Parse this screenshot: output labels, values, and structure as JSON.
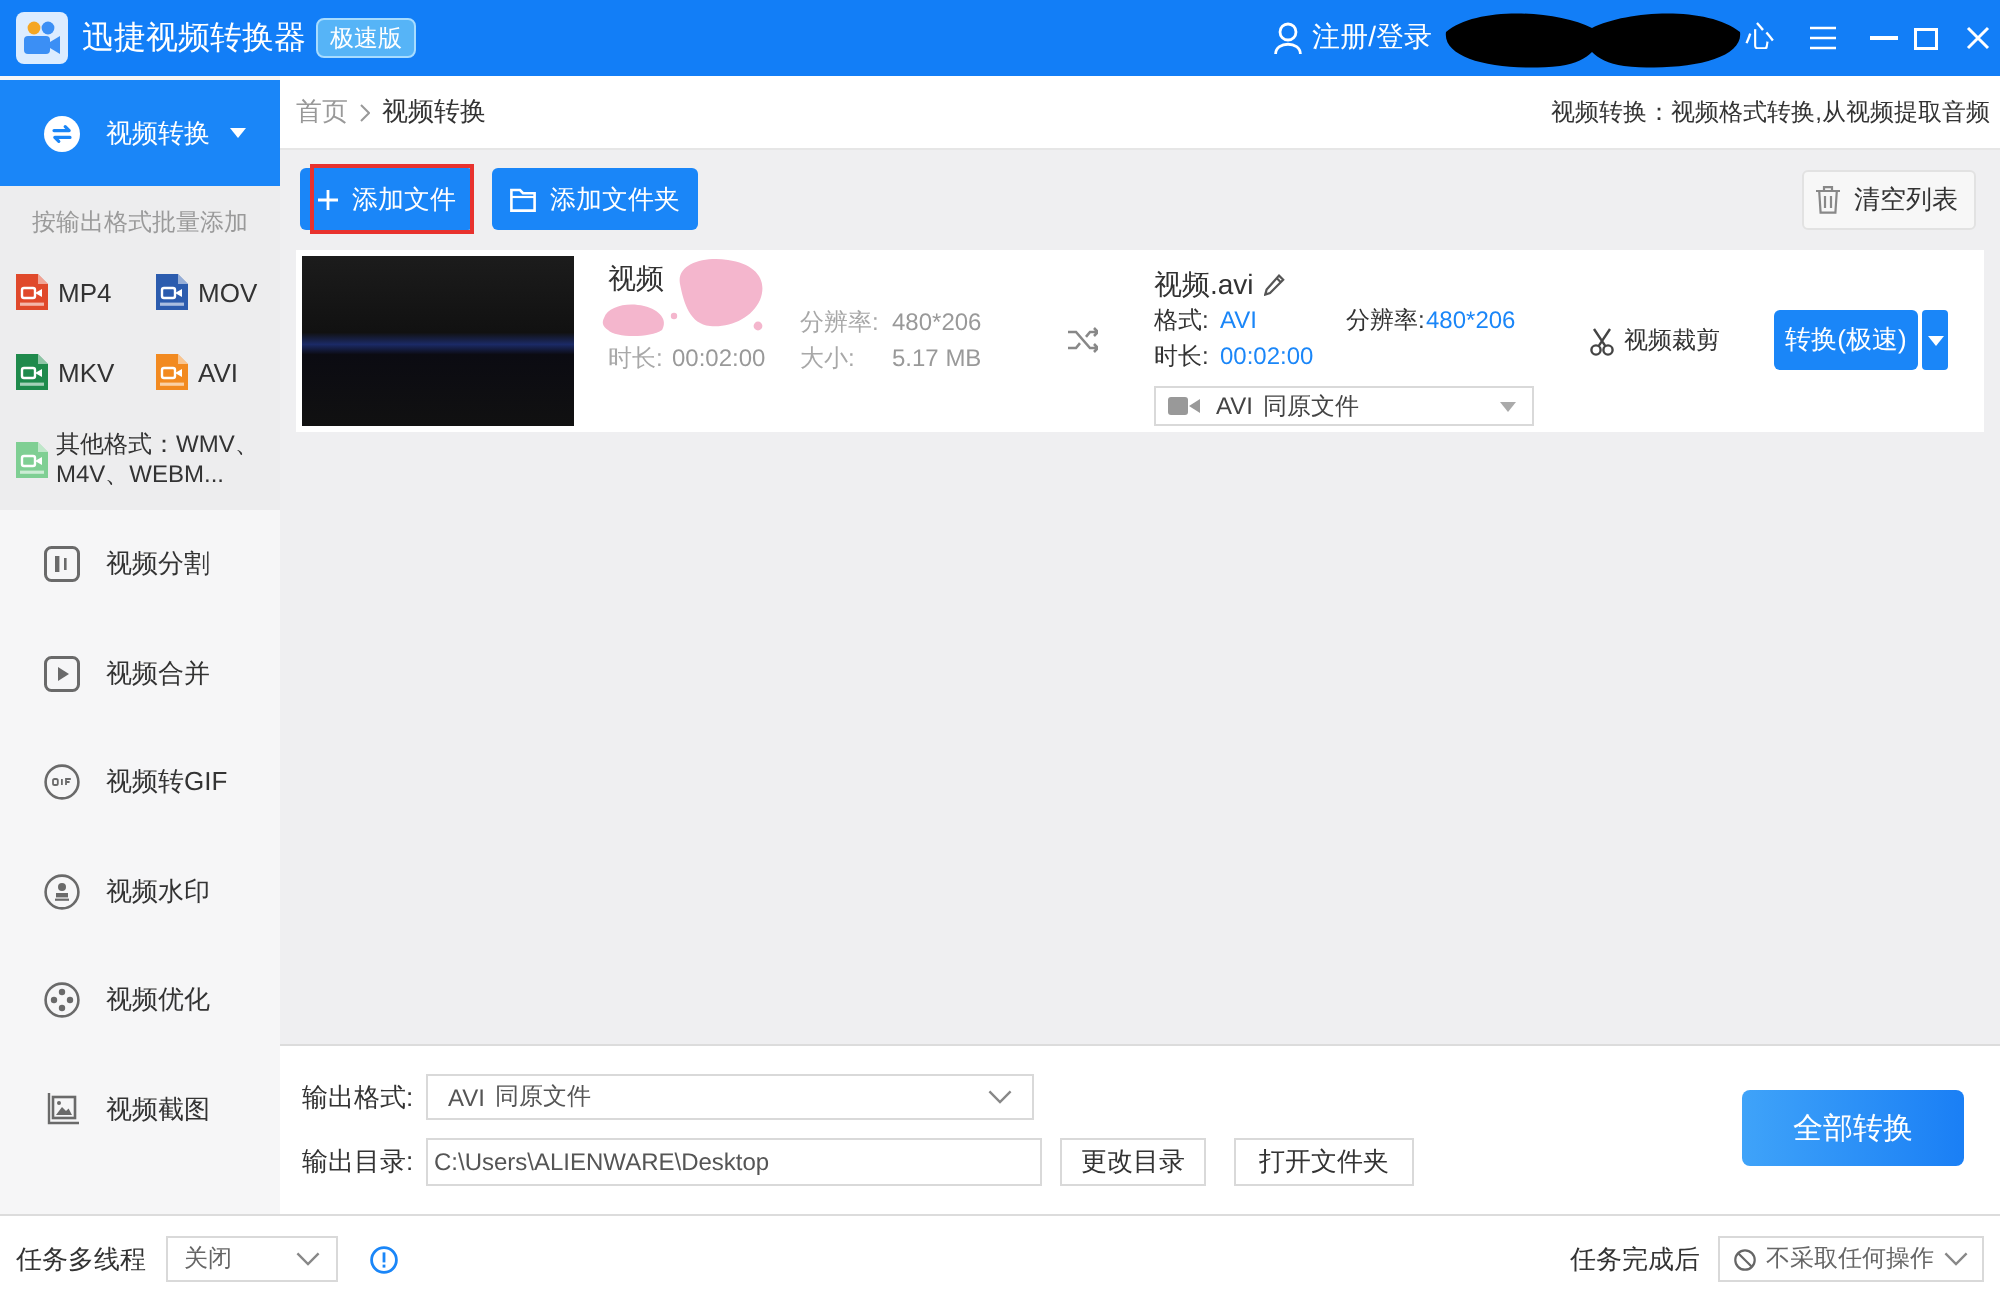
{
  "window": {
    "title": "迅捷视频转换器",
    "badge": "极速版",
    "login": "注册/登录",
    "account_tail": "心"
  },
  "sidebar": {
    "items": [
      {
        "label": "视频转换",
        "kind": "convert",
        "selected": true
      },
      {
        "label": "视频分割",
        "kind": "split",
        "selected": false
      },
      {
        "label": "视频合并",
        "kind": "merge",
        "selected": false
      },
      {
        "label": "视频转GIF",
        "kind": "gif",
        "selected": false
      },
      {
        "label": "视频水印",
        "kind": "watermark",
        "selected": false
      },
      {
        "label": "视频优化",
        "kind": "optimize",
        "selected": false
      },
      {
        "label": "视频截图",
        "kind": "screenshot",
        "selected": false
      }
    ],
    "format_panel": {
      "expanded": true,
      "hint": "按输出格式批量添加",
      "formats": [
        {
          "label": "MP4",
          "color": "#e0492b"
        },
        {
          "label": "MOV",
          "color": "#2c5cae"
        },
        {
          "label": "MKV",
          "color": "#1f8a4c"
        },
        {
          "label": "AVI",
          "color": "#f28a20"
        },
        {
          "label": "其他格式：WMV、M4V、WEBM...",
          "color": "#7fcf93"
        }
      ]
    }
  },
  "breadcrumb": [
    "首页",
    "视频转换"
  ],
  "description": "视频转换：视频格式转换,从视频提取音频",
  "toolbar": {
    "buttons": [
      {
        "label": "添加文件",
        "kind": "add_file",
        "highlighted": true
      },
      {
        "label": "添加文件夹",
        "kind": "add_folder",
        "highlighted": false
      }
    ],
    "clear": "清空列表"
  },
  "files": [
    {
      "source": {
        "name": "视频",
        "resolution": {
          "label": "分辨率:",
          "value": "480*206"
        },
        "duration": {
          "label": "时长:",
          "value": "00:02:00"
        },
        "size": {
          "label": "大小:",
          "value": "5.17 MB"
        }
      },
      "target": {
        "name": "视频.avi",
        "format": {
          "label": "格式:",
          "value": "AVI"
        },
        "resolution": {
          "label": "分辨率:",
          "value": "480*206"
        },
        "duration": {
          "label": "时长:",
          "value": "00:02:00"
        },
        "preset": {
          "format": "AVI",
          "quality": "同原文件"
        }
      },
      "crop": "视频裁剪",
      "convert": "转换(极速)"
    }
  ],
  "output": {
    "format_label": "输出格式:",
    "format": {
      "format": "AVI",
      "quality": "同原文件"
    },
    "folder_label": "输出目录:",
    "folder": "C:\\Users\\ALIENWARE\\Desktop",
    "change": "更改目录",
    "open": "打开文件夹",
    "convert_all": "全部转换"
  },
  "status_bar": {
    "threads_label": "任务多线程",
    "threads": "关闭",
    "after_label": "任务完成后",
    "after": "不采取任何操作"
  }
}
